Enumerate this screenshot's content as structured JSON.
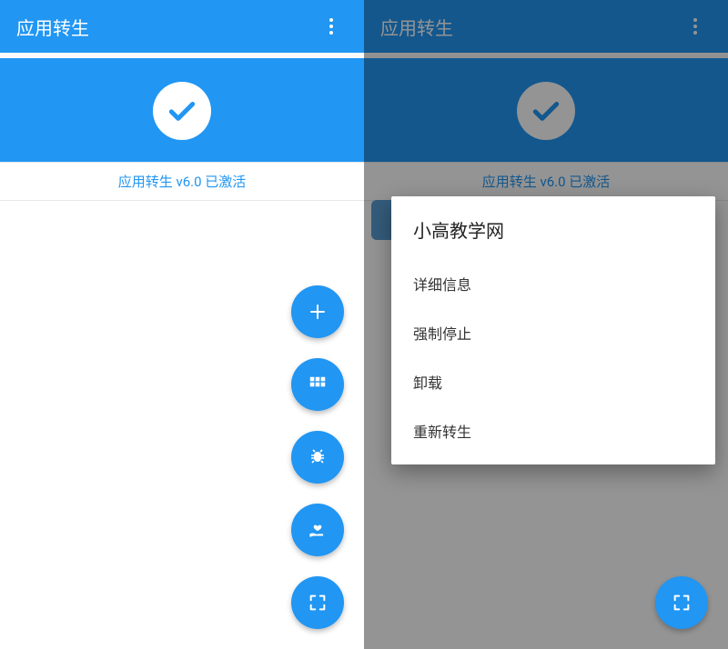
{
  "left": {
    "appbar": {
      "title": "应用转生"
    },
    "status": {
      "text": "应用转生 v6.0 已激活"
    },
    "fabs": {
      "add": "+",
      "grid": "grid",
      "bug": "bug",
      "heart": "heart",
      "expand": "expand"
    }
  },
  "right": {
    "appbar": {
      "title": "应用转生"
    },
    "status": {
      "text": "应用转生 v6.0 已激活"
    },
    "dialog": {
      "title": "小高教学网",
      "items": [
        "详细信息",
        "强制停止",
        "卸载",
        "重新转生"
      ]
    }
  }
}
